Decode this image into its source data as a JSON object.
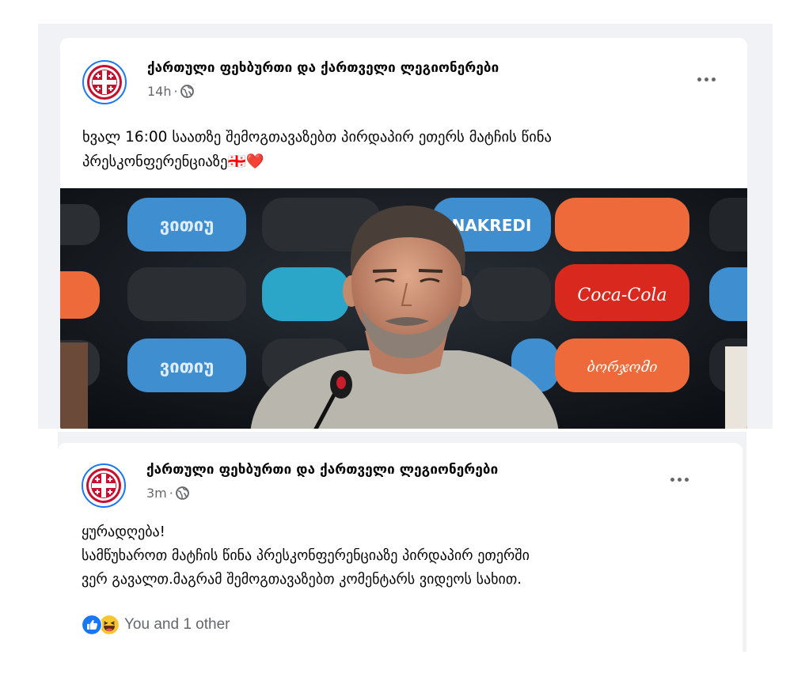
{
  "post1": {
    "page_name": "ქართული ფეხბურთი და ქართველი ლეგიონერები",
    "time": "14h",
    "privacy_icon": "globe-icon",
    "text": "ხვალ 16:00 საათზე შემოგთავაზებთ პირდაპირ ეთერს მატჩის წინა\nპრესკონფერენციაზე",
    "emoji": "🇬🇪❤️",
    "photo_backdrop_labels": [
      "ვითიუ",
      "NAKREDI",
      "Coca-Cola",
      "ბორჯომი",
      "ვითიუ"
    ]
  },
  "post2": {
    "page_name": "ქართული ფეხბურთი და ქართველი ლეგიონერები",
    "time": "3m",
    "privacy_icon": "globe-icon",
    "text": "ყურადღება!\nსამწუხაროთ მატჩის წინა პრესკონფერენციაზე პირდაპირ ეთერში\nვერ გავალთ.მაგრამ შემოგთავაზებთ კომენტარს ვიდეოს სახით.",
    "reactions": {
      "icons": [
        "like-icon",
        "haha-icon"
      ],
      "summary": "You and 1 other"
    }
  },
  "colors": {
    "fb_blue": "#1877f2",
    "secondary_text": "#65676b",
    "logo_red": "#c8102e"
  }
}
